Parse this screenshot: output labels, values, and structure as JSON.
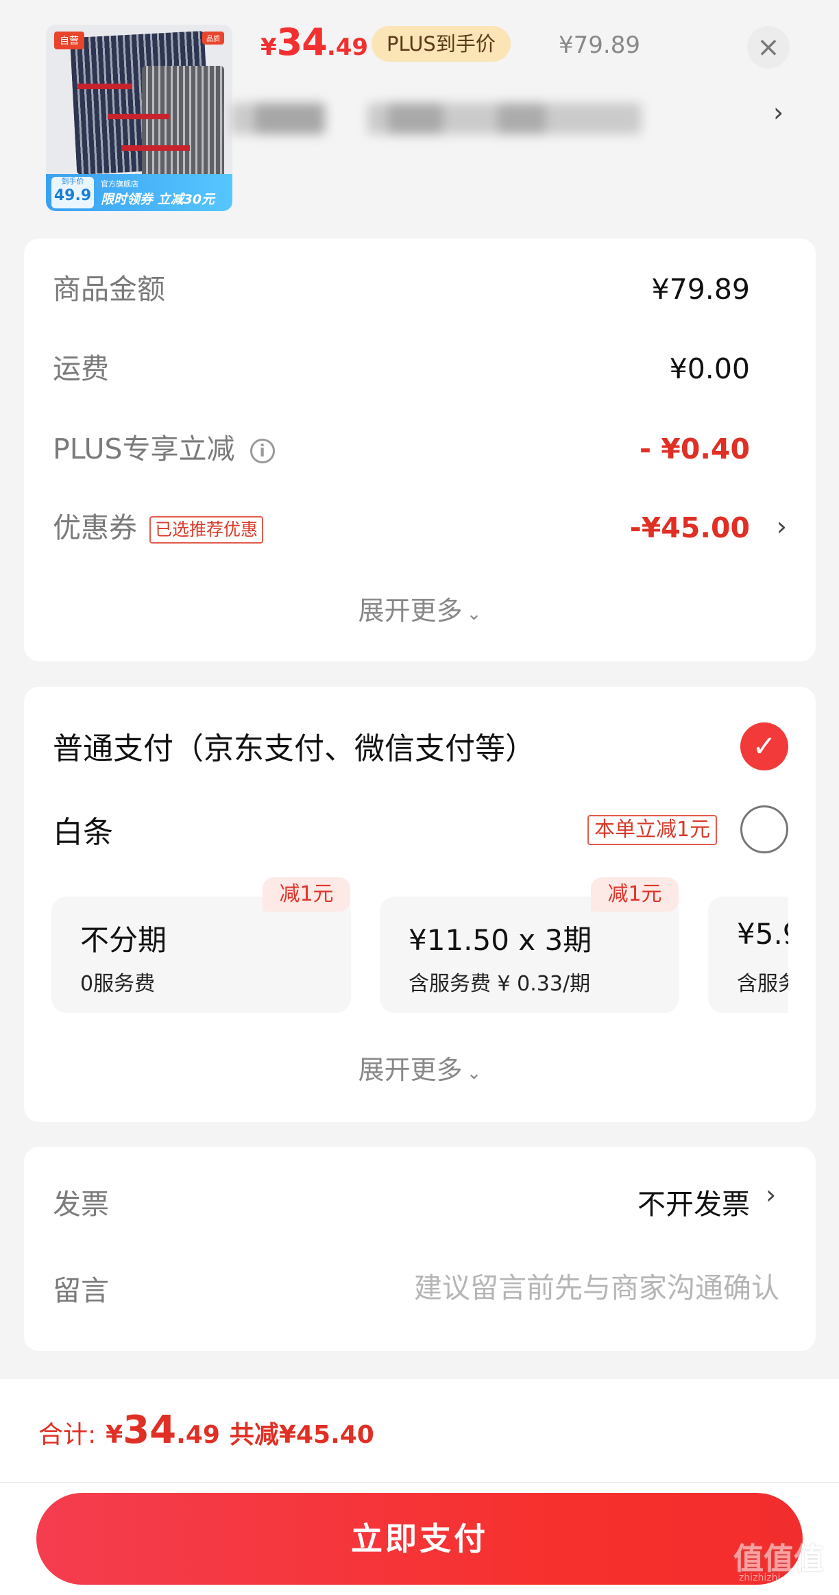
{
  "header": {
    "thumb_tag_left": "自营",
    "thumb_tag_right": "品质",
    "thumb_banner_price_label": "到手价",
    "thumb_banner_price": "49.9",
    "thumb_banner_shop": "官方旗舰店",
    "thumb_banner_promo": "限时领券 立减30元",
    "price_currency": "¥",
    "price_int": "34",
    "price_dec": ".49",
    "plus_badge": "PLUS到手价",
    "original_price": "¥79.89",
    "close_icon": "×",
    "chevron": "›"
  },
  "summary": {
    "items": [
      {
        "label": "商品金额",
        "value": "¥79.89"
      },
      {
        "label": "运费",
        "value": "¥0.00"
      },
      {
        "label": "PLUS专享立减",
        "value": "- ¥0.40"
      },
      {
        "label": "优惠券",
        "tag": "已选推荐优惠",
        "value": "-¥45.00"
      }
    ],
    "expand_label": "展开更多",
    "expand_caret": "⌄"
  },
  "payment": {
    "standard_label": "普通支付（京东支付、微信支付等）",
    "check_mark": "✓",
    "baitiao_label": "白条",
    "baitiao_badge": "本单立减1元",
    "plans": [
      {
        "title": "不分期",
        "subtitle": "0服务费",
        "badge": "减1元"
      },
      {
        "title": "¥11.50 x 3期",
        "subtitle": "含服务费 ¥ 0.33/期",
        "badge": "减1元"
      },
      {
        "title": "¥5.9",
        "subtitle": "含服务"
      }
    ],
    "expand_label": "展开更多",
    "expand_caret": "⌄"
  },
  "extra": {
    "invoice_label": "发票",
    "invoice_value": "不开发票",
    "message_label": "留言",
    "message_placeholder": "建议留言前先与商家沟通确认"
  },
  "footer": {
    "total_label": "合计:",
    "total_currency": "¥",
    "total_int": "34",
    "total_dec": ".49",
    "saved_text": "共减¥45.40",
    "pay_button": "立即支付",
    "watermark_big": "值值值",
    "watermark_small": "zhizhizhi.com"
  },
  "colors": {
    "accent_red": "#f23030",
    "plus_badge_bg": "#fbe4b6",
    "page_bg": "#f4f4f4"
  }
}
